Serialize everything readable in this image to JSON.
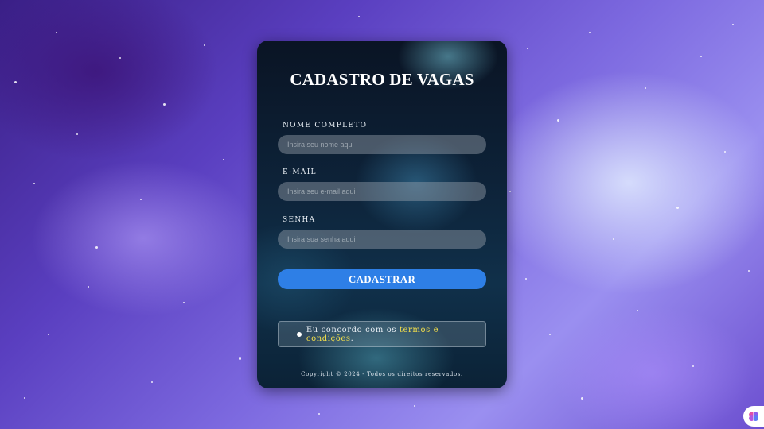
{
  "form": {
    "title": "CADASTRO DE VAGAS",
    "fields": [
      {
        "label": "NOME COMPLETO",
        "placeholder": "Insira seu nome aqui",
        "value": ""
      },
      {
        "label": "E-MAIL",
        "placeholder": "Insira seu e-mail aqui",
        "value": ""
      },
      {
        "label": "SENHA",
        "placeholder": "Insira sua senha aqui",
        "value": ""
      }
    ],
    "submit_label": "CADASTRAR",
    "terms": {
      "prefix": "Eu concordo com os ",
      "link_text": "termos e condições",
      "suffix": "."
    },
    "copyright": "Copyright © 2024 - Todos os direitos reservados."
  },
  "colors": {
    "accent": "#2e7fe6",
    "link": "#f5e04a"
  },
  "icons": {
    "corner_badge": "brain-icon"
  }
}
